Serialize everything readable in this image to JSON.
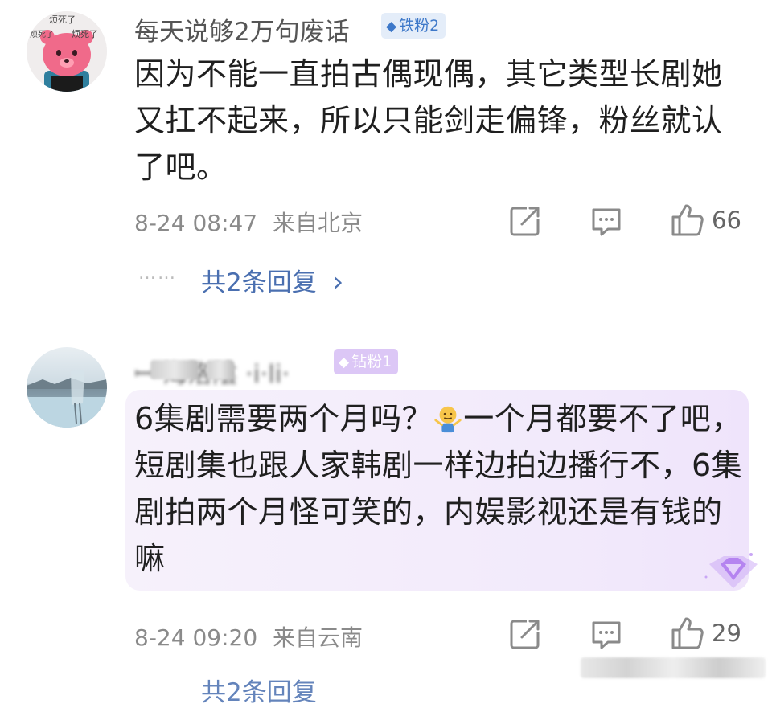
{
  "comments": [
    {
      "username": "每天说够2万句废话",
      "badge": "铁粉2",
      "avatar_caption_1": "烦死了",
      "avatar_caption_2": "烦死了",
      "avatar_caption_3": "烦死了",
      "text": "因为不能一直拍古偶现偶，其它类型长剧她又扛不起来，所以只能剑走偏锋，粉丝就认了吧。",
      "date": "8-24 08:47",
      "location": "来自北京",
      "likes": "66",
      "reply_dots": "……",
      "replies_label": "共2条回复",
      "replies_arrow": "›"
    },
    {
      "username": "ꟷ 海洛陰 ·i·li·",
      "badge": "钻粉1",
      "text_part1": "6集剧需要两个月吗？",
      "text_part2": "一个月都要不了吧，短剧集也跟人家韩剧一样边拍边播行不，6集剧拍两个月怪可笑的，内娱影视还是有钱的嘛",
      "date": "8-24 09:20",
      "location": "来自云南",
      "likes": "29",
      "replies_label": "共2条回复"
    }
  ],
  "icons": {
    "repost": "repost-icon",
    "comment": "comment-icon",
    "like": "thumbs-up-icon",
    "emoji": "shrug-emoji-icon",
    "badge_iron": "diamond-gem-icon",
    "badge_diamond": "diamond-gem-icon",
    "highlight": "purple-diamond-icon"
  },
  "colors": {
    "link": "#4a6fb0",
    "iron_badge": "#3d78c9",
    "diamond_badge": "#dcc7f6",
    "meta": "#8a8a8a"
  }
}
